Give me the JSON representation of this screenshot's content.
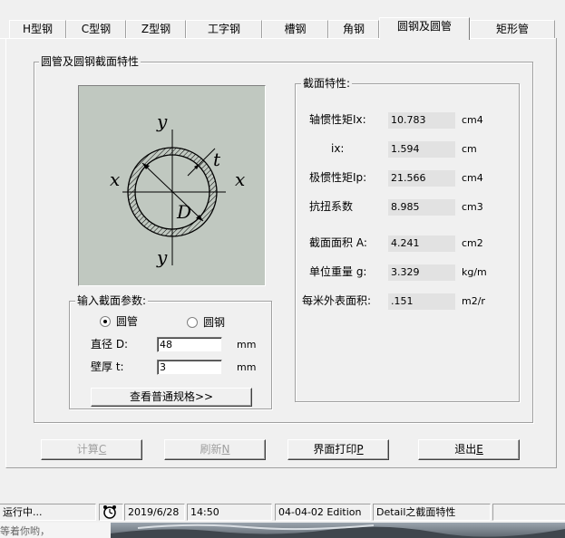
{
  "tabs": [
    "H型钢",
    "C型钢",
    "Z型钢",
    "工字钢",
    "槽钢",
    "角钢",
    "圆钢及圆管",
    "矩形管"
  ],
  "active_tab": "圆钢及圆管",
  "section_group_title": "圆管及圆钢截面特性",
  "drawing": {
    "labels": {
      "y_top": "y",
      "y_bottom": "y",
      "x_left": "x",
      "x_right": "x",
      "t": "t",
      "D": "D"
    }
  },
  "input_group": {
    "title": "输入截面参数:",
    "radio_tube": "圆管",
    "radio_bar": "圆钢",
    "selected": "圆管",
    "diameter_label": "直径 D:",
    "diameter_value": "48",
    "diameter_unit": "mm",
    "thickness_label": "壁厚 t:",
    "thickness_value": "3",
    "thickness_unit": "mm",
    "view_spec_button": "查看普通规格>>"
  },
  "props": {
    "title": "截面特性:",
    "rows": [
      {
        "label": "轴惯性矩Ix:",
        "value": "10.783",
        "unit": "cm4"
      },
      {
        "label": "ix:",
        "value": "1.594",
        "unit": "cm"
      },
      {
        "label": "极惯性矩Ip:",
        "value": "21.566",
        "unit": "cm4"
      },
      {
        "label": "抗扭系数",
        "value": "8.985",
        "unit": "cm3"
      },
      {
        "label": "截面面积 A:",
        "value": "4.241",
        "unit": "cm2"
      },
      {
        "label": "单位重量 g:",
        "value": "3.329",
        "unit": "kg/m"
      },
      {
        "label": "每米外表面积:",
        "value": ".151",
        "unit": "m2/m"
      }
    ]
  },
  "buttons": {
    "calc": "计算",
    "calc_key": "C",
    "refresh": "刷新",
    "refresh_key": "N",
    "print": "界面打印",
    "print_key": "P",
    "exit": "退出",
    "exit_key": "E"
  },
  "statusbar": {
    "state": "运行中...",
    "date": "2019/6/28",
    "time": "14:50",
    "edition": "04-04-02 Edition",
    "detail": "Detail之截面特性"
  },
  "taskbar_hint": "等着你哟，",
  "colors": {
    "face": "#f0f0f0",
    "drawing_bg": "#c0c8c0",
    "readout_bg": "#e2e2e2",
    "disabled_text": "#a0a0a0"
  }
}
